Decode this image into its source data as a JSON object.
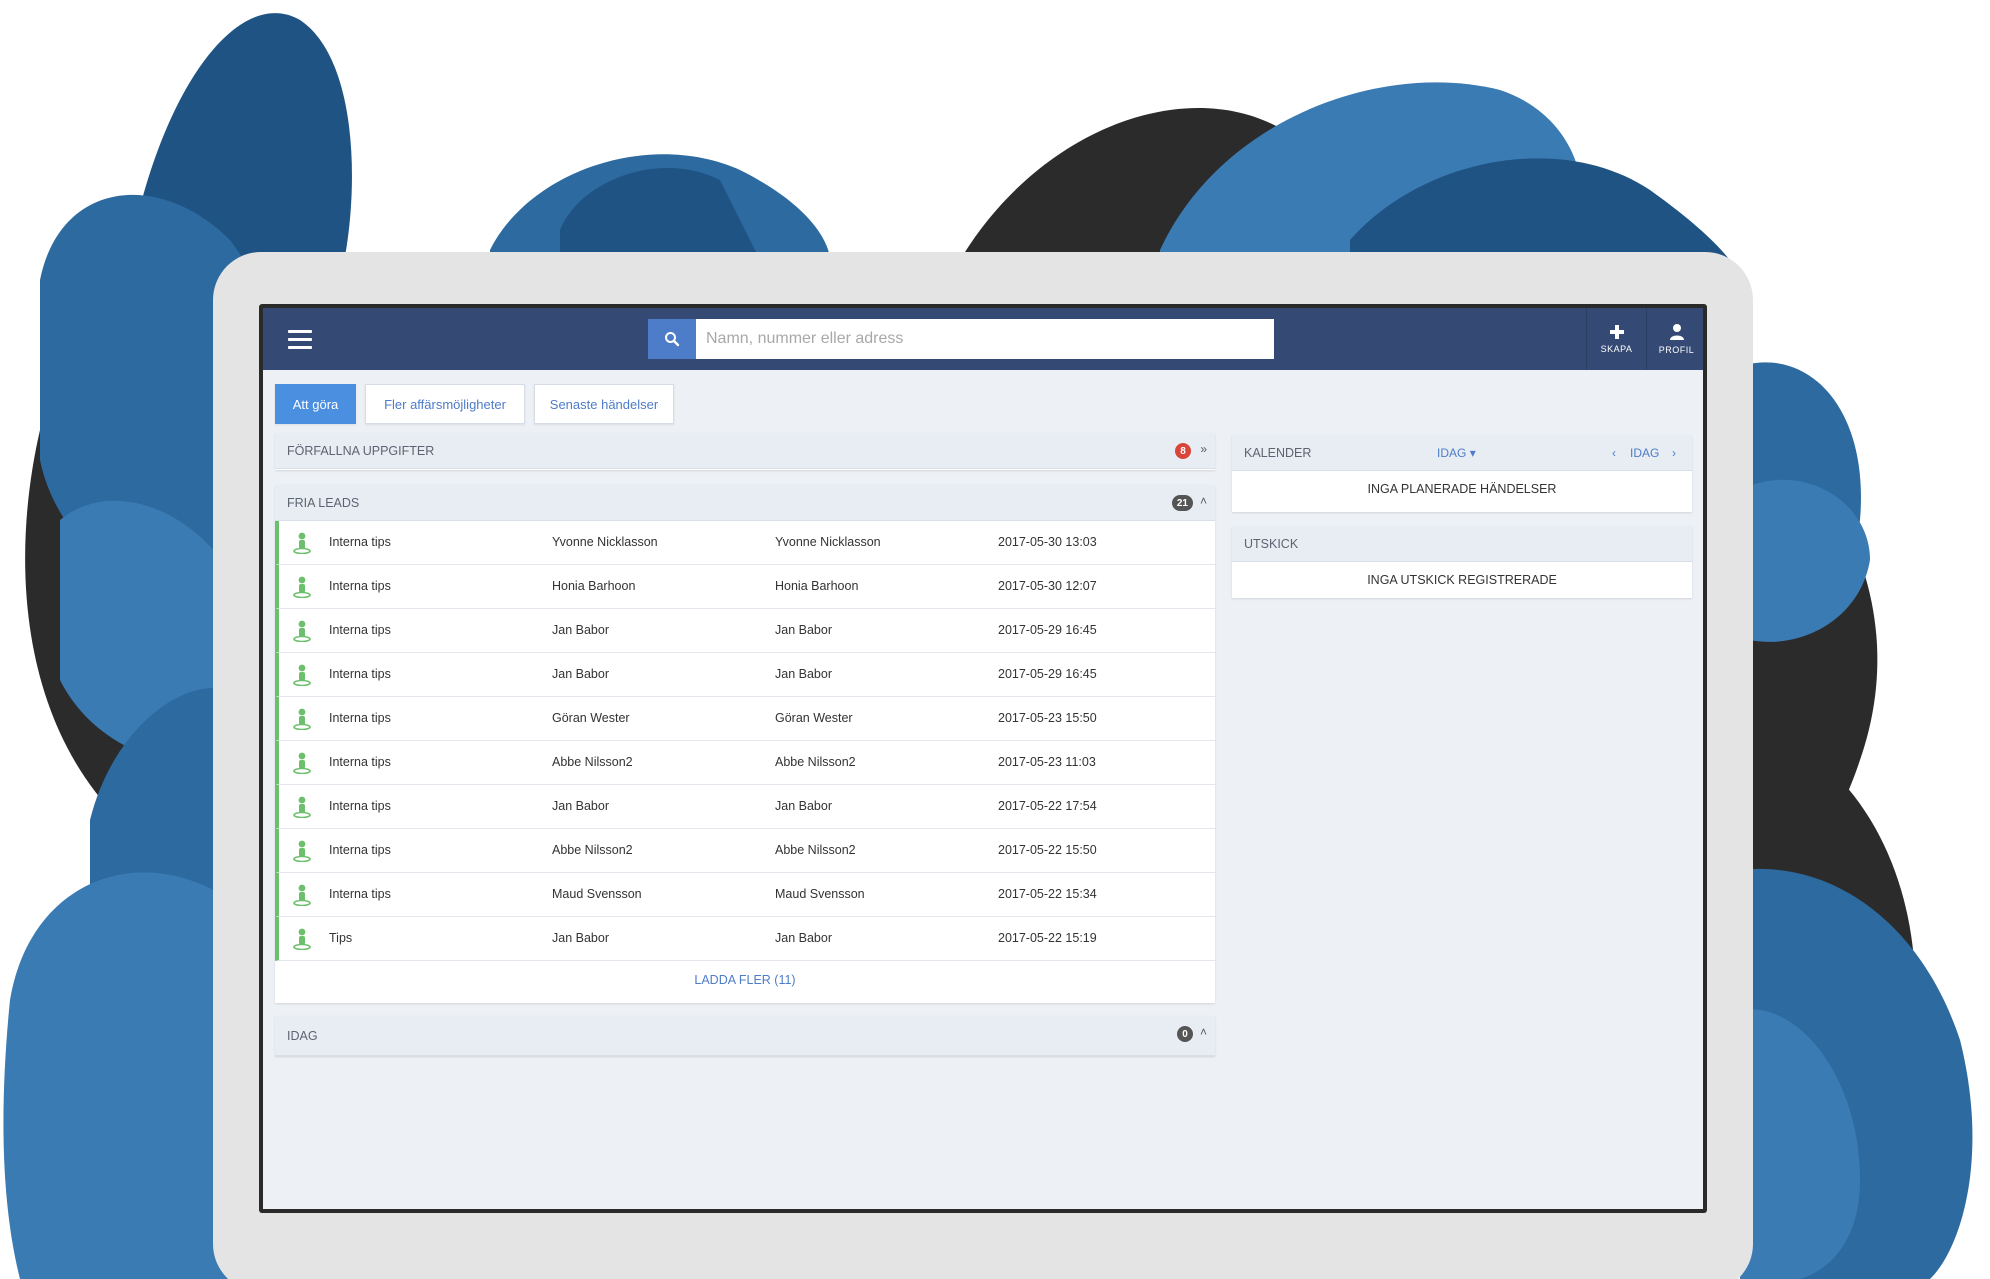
{
  "colors": {
    "topbar": "#344a74",
    "accent": "#4a8fe0",
    "lead_green": "#6cbf6c",
    "overdue_badge": "#d9453b",
    "neutral_badge": "#555555",
    "blob_blue": "#2c6aa0",
    "blob_dark": "#2b2b2b"
  },
  "topbar": {
    "menu_icon": "hamburger-icon",
    "search": {
      "placeholder": "Namn, nummer eller adress",
      "value": "",
      "icon": "search-icon"
    },
    "create": {
      "label": "SKAPA",
      "icon": "plus-icon"
    },
    "profile": {
      "label": "PROFIL",
      "icon": "user-icon"
    }
  },
  "tabs": [
    {
      "label": "Att göra",
      "active": true
    },
    {
      "label": "Fler affärsmöjligheter",
      "active": false
    },
    {
      "label": "Senaste händelser",
      "active": false
    }
  ],
  "overdue": {
    "title": "FÖRFALLNA UPPGIFTER",
    "count": "8",
    "chevron": "double-chevron-down-icon"
  },
  "leads": {
    "title": "FRIA LEADS",
    "count": "21",
    "chevron": "double-chevron-up-icon",
    "rows": [
      {
        "source": "Interna tips",
        "name": "Yvonne Nicklasson",
        "contact": "Yvonne Nicklasson",
        "date": "2017-05-30 13:03"
      },
      {
        "source": "Interna tips",
        "name": "Honia Barhoon",
        "contact": "Honia Barhoon",
        "date": "2017-05-30 12:07"
      },
      {
        "source": "Interna tips",
        "name": "Jan Babor",
        "contact": "Jan Babor",
        "date": "2017-05-29 16:45"
      },
      {
        "source": "Interna tips",
        "name": "Jan Babor",
        "contact": "Jan Babor",
        "date": "2017-05-29 16:45"
      },
      {
        "source": "Interna tips",
        "name": "Göran Wester",
        "contact": "Göran Wester",
        "date": "2017-05-23 15:50"
      },
      {
        "source": "Interna tips",
        "name": "Abbe Nilsson2",
        "contact": "Abbe Nilsson2",
        "date": "2017-05-23 11:03"
      },
      {
        "source": "Interna tips",
        "name": "Jan Babor",
        "contact": "Jan Babor",
        "date": "2017-05-22 17:54"
      },
      {
        "source": "Interna tips",
        "name": "Abbe Nilsson2",
        "contact": "Abbe Nilsson2",
        "date": "2017-05-22 15:50"
      },
      {
        "source": "Interna tips",
        "name": "Maud Svensson",
        "contact": "Maud Svensson",
        "date": "2017-05-22 15:34"
      },
      {
        "source": "Tips",
        "name": "Jan Babor",
        "contact": "Jan Babor",
        "date": "2017-05-22 15:19"
      }
    ],
    "load_more": "LADDA FLER (11)"
  },
  "today": {
    "title": "IDAG",
    "count": "0",
    "chevron": "double-chevron-up-icon"
  },
  "calendar": {
    "title": "KALENDER",
    "view_dropdown": "IDAG",
    "nav_label": "IDAG",
    "prev_icon": "chevron-left-icon",
    "next_icon": "chevron-right-icon",
    "empty_text": "INGA PLANERADE HÄNDELSER"
  },
  "mailings": {
    "title": "UTSKICK",
    "empty_text": "INGA UTSKICK REGISTRERADE"
  }
}
